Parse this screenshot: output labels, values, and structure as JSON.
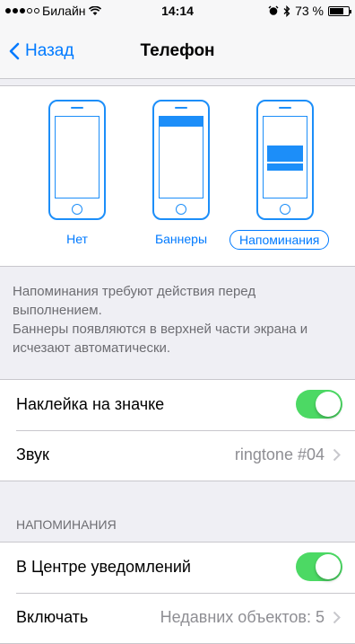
{
  "status_bar": {
    "carrier": "Билайн",
    "signal_dots_filled": 3,
    "signal_dots_total": 5,
    "time": "14:14",
    "battery": "73 %",
    "battery_level": 0.73
  },
  "nav": {
    "back_label": "Назад",
    "title": "Телефон"
  },
  "alert_style": {
    "options": [
      {
        "label": "Нет",
        "selected": false
      },
      {
        "label": "Баннеры",
        "selected": false
      },
      {
        "label": "Напоминания",
        "selected": true
      }
    ]
  },
  "footer": {
    "line1": "Напоминания требуют действия перед выполнением.",
    "line2": "Баннеры появляются в верхней части экрана и исчезают автоматически."
  },
  "settings": {
    "badge_label": "Наклейка на значке",
    "badge_on": true,
    "sound_label": "Звук",
    "sound_value": "ringtone #04"
  },
  "reminders": {
    "header": "НАПОМИНАНИЯ",
    "center_label": "В Центре уведомлений",
    "center_on": true,
    "include_label": "Включать",
    "include_value": "Недавних объектов: 5"
  },
  "colors": {
    "accent": "#007aff",
    "toggle_on": "#4cd964",
    "background": "#efeff4"
  }
}
